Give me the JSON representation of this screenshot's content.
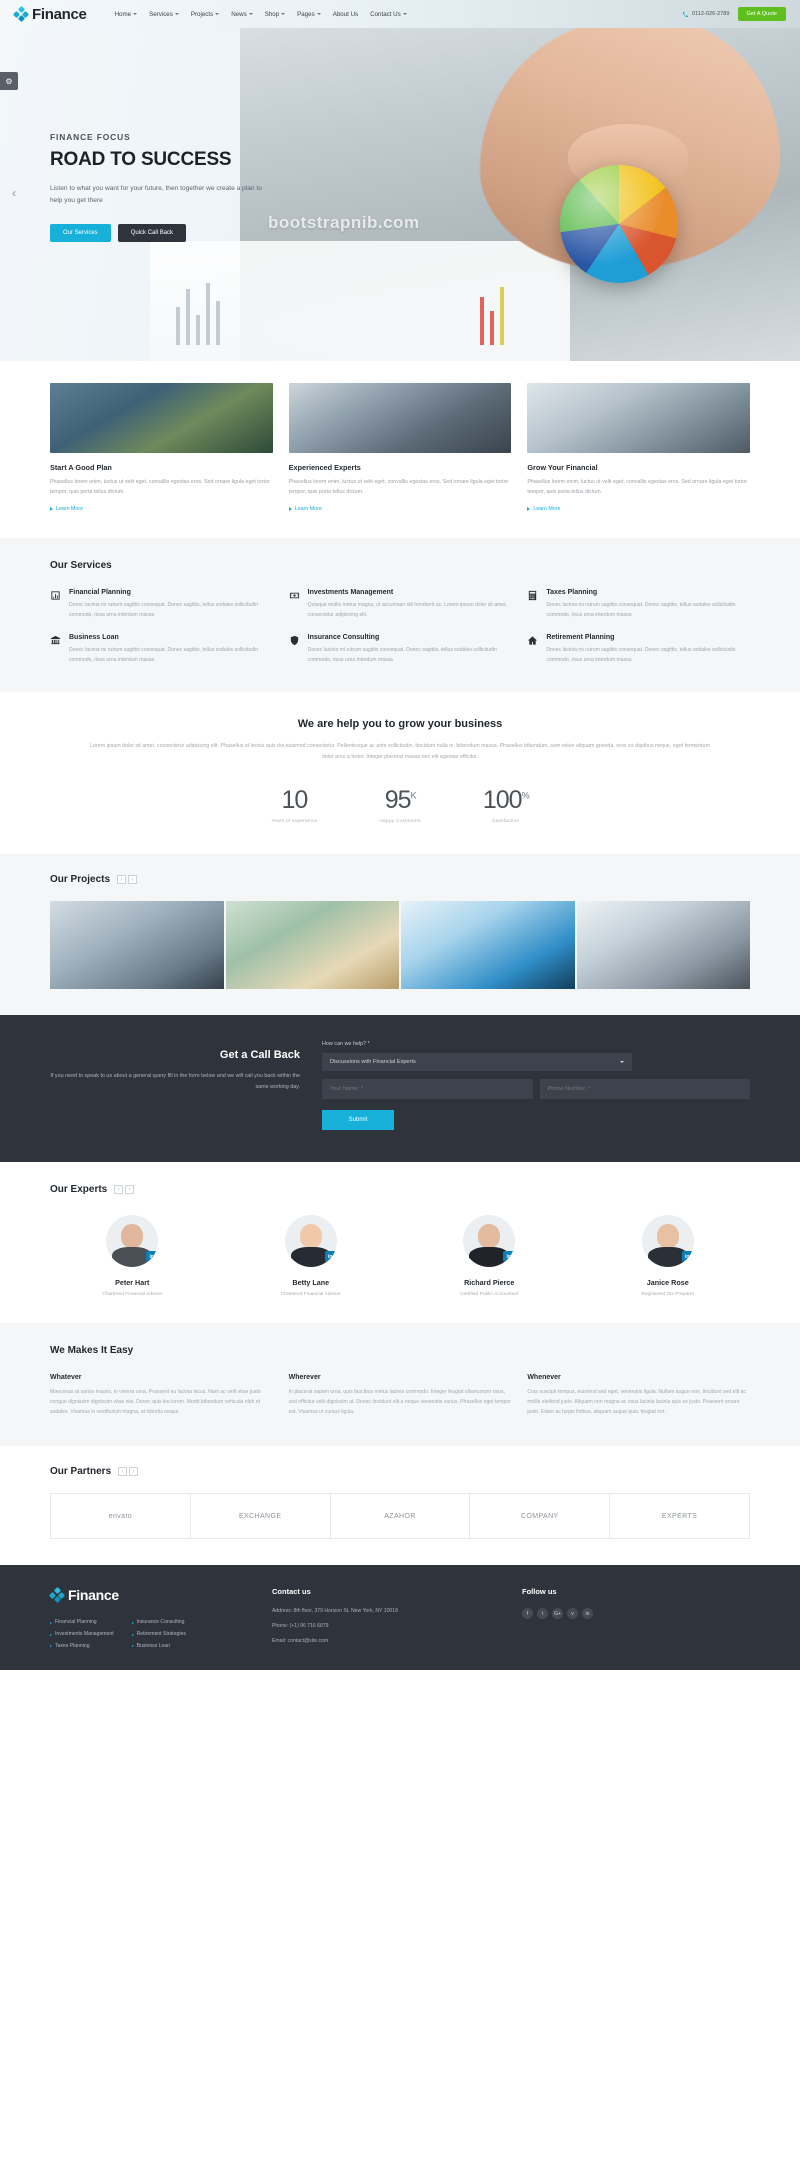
{
  "header": {
    "logo_text": "Finance",
    "nav": [
      {
        "label": "Home",
        "has_caret": true
      },
      {
        "label": "Services",
        "has_caret": true
      },
      {
        "label": "Projects",
        "has_caret": true
      },
      {
        "label": "News",
        "has_caret": true
      },
      {
        "label": "Shop",
        "has_caret": true
      },
      {
        "label": "Pages",
        "has_caret": true
      },
      {
        "label": "About Us",
        "has_caret": false
      },
      {
        "label": "Contact Us",
        "has_caret": true
      }
    ],
    "phone": "0112-026-2789",
    "quote_button": "Get A Quote"
  },
  "hero": {
    "kicker": "FINANCE FOCUS",
    "title": "ROAD TO SUCCESS",
    "subtitle": "Listen to what you want for your future, then together we create a plan to help you get there",
    "primary_button": "Our Services",
    "secondary_button": "Quick Call Back",
    "watermark": "bootstrapnib.com"
  },
  "features": [
    {
      "title": "Start A Good Plan",
      "text": "Phasellus lorem enim, luctus ut velit eget, convallis egestas eros. Sed ornare ligula eget tortor tempor, quis porta tellus dictum.",
      "link": "Learn More"
    },
    {
      "title": "Experienced Experts",
      "text": "Phasellus lorem enim, luctus ut velit eget, convallis egestas eros. Sed ornare ligula eget tortor tempor, quis porta tellus dictum.",
      "link": "Learn More"
    },
    {
      "title": "Grow Your Financial",
      "text": "Phasellus lorem enim, luctus ut velit eget, convallis egestas eros. Sed ornare ligula eget tortor tempor, quis porta tellus dictum.",
      "link": "Learn More"
    }
  ],
  "services": {
    "title": "Our Services",
    "items": [
      {
        "icon": "bar-chart-icon",
        "name": "Financial Planning",
        "text": "Donec lacinia mi rutrum sagittis consequat. Donec sagittis, tellus sodales sollicitudin commodo, risus urna interdum massa"
      },
      {
        "icon": "money-icon",
        "name": "Investments Management",
        "text": "Quisque mollis metus magna, ut accumsan elit hendrerit ac. Lorem ipsum dolor sit amet, consectetur adipiscing elit."
      },
      {
        "icon": "calculator-icon",
        "name": "Taxes Planning",
        "text": "Donec lacinia mi rutrum sagittis consequat. Donec sagittis, tellus sodales sollicitudin commodo, risus urna interdum massa"
      },
      {
        "icon": "bank-icon",
        "name": "Business Loan",
        "text": "Donec lacinia mi rutrum sagittis consequat. Donec sagittis, tellus sodales sollicitudin commodo, risus urna interdum massa"
      },
      {
        "icon": "shield-icon",
        "name": "Insurance Consulting",
        "text": "Donec lacinia mi rutrum sagittis consequat. Donec sagittis, tellus sodales sollicitudin commodo, risus urna interdum massa"
      },
      {
        "icon": "home-icon",
        "name": "Retirement Planning",
        "text": "Donec lacinia mi rutrum sagittis consequat. Donec sagittis, tellus sodales sollicitudin commodo, risus urna interdum massa"
      }
    ]
  },
  "grow": {
    "title": "We are help you to grow your business",
    "text": "Lorem ipsum dolor sit amet, consectetur adipiscing elit. Phasellus id lectus quis dui euismod consectetur. Pellentesque ac ante sollicitudin, tincidunt nulla in, bibendum massa. Phasellus bibendum, sem velue aliquam gravida, eros ex dapibus neque, eget fermentum dolor arcu a tortor. Integer placerat massa nec elit egestas efficitur.",
    "counters": [
      {
        "number": "10",
        "suffix": "",
        "label": "Years of experience"
      },
      {
        "number": "95",
        "suffix": "K",
        "label": "Happy Customers"
      },
      {
        "number": "100",
        "suffix": "%",
        "label": "Satisfaction"
      }
    ]
  },
  "projects": {
    "title": "Our Projects",
    "prev": "‹",
    "next": "›"
  },
  "callback": {
    "title": "Get a Call Back",
    "text": "If you need to speak to us about a general query fill in the form below and we will call you back within the same working day.",
    "select_label": "How can we help? *",
    "select_value": "Discussions with Financial Experts",
    "name_placeholder": "Your Name: *",
    "phone_placeholder": "Phone Number: *",
    "submit": "Submit"
  },
  "experts": {
    "title": "Our Experts",
    "prev": "‹",
    "next": "›",
    "items": [
      {
        "name": "Peter Hart",
        "role": "Chartered Financial Advisor",
        "badge": "in"
      },
      {
        "name": "Betty Lane",
        "role": "Chartered Financial Advisor",
        "badge": "in"
      },
      {
        "name": "Richard Pierce",
        "role": "Certified Public Accountant",
        "badge": "in"
      },
      {
        "name": "Janice Rose",
        "role": "Registered Tax Preparer",
        "badge": "in"
      }
    ]
  },
  "easy": {
    "title": "We Makes It Easy",
    "items": [
      {
        "heading": "Whatever",
        "text": "Maecenas at varius mauris, in viverra urna. Praesent eu lacinia lacus. Nam ac velit vitae justo congue dignissim dignissim vitae nisi. Donec quis leo lorem. Morbi bibendum vehicula nibh et sodales. Vivamus in vestibulum magna, at lobortis neque."
      },
      {
        "heading": "Wherever",
        "text": "In placerat sapien urna, quis faucibus metus lacinia commodo. Integer feugiat ullamcorper risus, sed efficitur velit dignissim at. Donec tincidunt elit a neque venenatis varius. Phasellus eget tempor est. Vivamus ut cursus ligula."
      },
      {
        "heading": "Whenever",
        "text": "Cras suscipit tempus, euismod sed eget, venenatis ligula. Nullam augue non, tincidunt sed elit ac mollis eleifend justo. Aliquam non magna ac risus lacinia lacinia quis ex justo. Praesent ornare justo. Etiam ac turpis finibus, aliquam augue quis, feugiat est."
      }
    ]
  },
  "partners": {
    "title": "Our Partners",
    "prev": "‹",
    "next": "›",
    "items": [
      {
        "name": "envato"
      },
      {
        "name": "EXCHANGE"
      },
      {
        "name": "AZAHOR"
      },
      {
        "name": "COMPANY"
      },
      {
        "name": "EXPERTS"
      }
    ]
  },
  "footer": {
    "logo_text": "Finance",
    "links_col1": [
      "Financial Planning",
      "Investments Management",
      "Taxes Planning"
    ],
    "links_col2": [
      "Insurance Consulting",
      "Retirement Strategies",
      "Business Loan"
    ],
    "contact_heading": "Contact us",
    "address": "Address: 8th floor, 379 Horizon St, New York, NY 10018",
    "phone": "Phone: (+1) 96 716 6879",
    "email": "Email: contact@site.com",
    "follow_heading": "Follow us",
    "socials": [
      "f",
      "t",
      "G+",
      "v",
      "in"
    ]
  },
  "colors": {
    "accent": "#16b0d8",
    "green": "#5fbf1f",
    "dark": "#2f343c",
    "light_bg": "#f4f6f7"
  }
}
